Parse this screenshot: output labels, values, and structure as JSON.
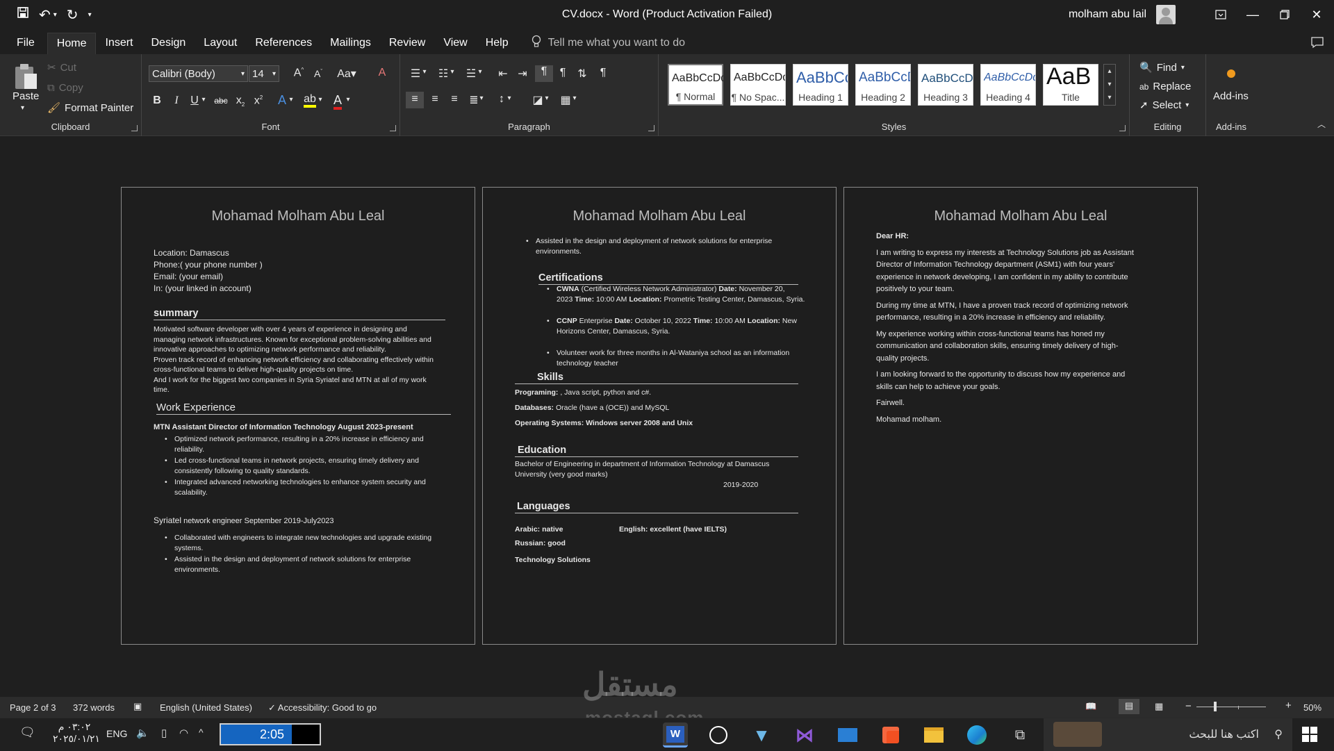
{
  "window": {
    "title": "CV.docx  -  Word (Product Activation Failed)",
    "user": "molham abu lail"
  },
  "tabs": [
    "File",
    "Home",
    "Insert",
    "Design",
    "Layout",
    "References",
    "Mailings",
    "Review",
    "View",
    "Help"
  ],
  "tell_me": "Tell me what you want to do",
  "ribbon": {
    "clipboard": {
      "paste": "Paste",
      "cut": "Cut",
      "copy": "Copy",
      "format_painter": "Format Painter",
      "label": "Clipboard"
    },
    "font": {
      "name": "Calibri (Body)",
      "size": "14",
      "label": "Font"
    },
    "paragraph": {
      "label": "Paragraph"
    },
    "styles": {
      "label": "Styles",
      "items": [
        {
          "preview": "AaBbCcDd",
          "name": "¶ Normal"
        },
        {
          "preview": "AaBbCcDd",
          "name": "¶ No Spac..."
        },
        {
          "preview": "AaBbCc",
          "name": "Heading 1"
        },
        {
          "preview": "AaBbCcD",
          "name": "Heading 2"
        },
        {
          "preview": "AaBbCcD",
          "name": "Heading 3"
        },
        {
          "preview": "AaBbCcDd",
          "name": "Heading 4"
        },
        {
          "preview": "AaB",
          "name": "Title"
        }
      ]
    },
    "editing": {
      "find": "Find",
      "replace": "Replace",
      "select": "Select",
      "label": "Editing"
    },
    "addins": {
      "button": "Add-ins",
      "label": "Add-ins"
    }
  },
  "doc": {
    "name_header": "Mohamad Molham Abu Leal",
    "page1": {
      "location": "Location: Damascus",
      "phone": "Phone:( your phone number )",
      "email": "Email: (your email)",
      "linkedin": "In: (your linked in account)",
      "summary_title": "summary",
      "summary_lines": [
        "Motivated software developer with over 4 years of experience in designing and",
        "managing network infrastructures. Known for exceptional problem-solving abilities and",
        "innovative approaches to optimizing network performance and reliability.",
        "Proven track record of enhancing network efficiency and collaborating effectively within",
        "cross-functional teams to deliver high-quality projects on time.",
        "And I work for the biggest two companies in Syria Syriatel and MTN at all of my work",
        "time."
      ],
      "work_title": "Work Experience",
      "mtn_title": "MTN Assistant Director of Information Technology August 2023-present",
      "mtn_bullets": [
        [
          "Optimized network performance, resulting in a 20% increase in efficiency and",
          "reliability."
        ],
        [
          "Led cross-functional teams in network projects, ensuring timely delivery and",
          "consistently following to quality standards."
        ],
        [
          "Integrated advanced networking technologies to enhance system security and",
          "scalability."
        ]
      ],
      "syriatel_company": "Syriatel",
      "syriatel_rest": " network engineer September 2019-July2023",
      "syriatel_bullets": [
        [
          "Collaborated with engineers to integrate new technologies and upgrade existing",
          "systems."
        ],
        [
          "Assisted in the design and deployment of network solutions for enterprise",
          "environments."
        ]
      ]
    },
    "page2": {
      "bullet": [
        "Assisted in the design and deployment of network solutions for enterprise",
        "environments."
      ],
      "cert_title": "Certifications",
      "cert1": {
        "b1": "CWNA",
        "t1": " (Certified Wireless Network Administrator) ",
        "b2": "Date:",
        "t2": " November 20,",
        "line2_a": "2023 ",
        "b3": "Time:",
        "t3": " 10:00 AM ",
        "b4": "Location:",
        "t4": " Prometric Testing Center, Damascus, Syria."
      },
      "cert2": {
        "b1": "CCNP",
        "t1": " Enterprise ",
        "b2": "Date:",
        "t2": " October 10, 2022 ",
        "b3": "Time:",
        "t3": " 10:00 AM ",
        "b4": "Location:",
        "t4": " New",
        "line2": "Horizons Center, Damascus, Syria."
      },
      "cert3": [
        "Volunteer work for three months in Al-Wataniya school as an information",
        "technology teacher"
      ],
      "skills_title": "Skills",
      "skill1_b": "Programing:",
      "skill1_t": " , Java script, python and c#.",
      "skill2_b": "Databases:",
      "skill2_t": " Oracle (have a (OCE)) and MySQL",
      "skill3_b": "Operating Systems: Windows server 2008 and Unix",
      "edu_title": "Education",
      "edu_lines": [
        "Bachelor of Engineering in department of Information Technology at Damascus",
        "University (very good marks)"
      ],
      "edu_year": "2019-2020",
      "lang_title": "Languages",
      "lang_arabic": "Arabic: native",
      "lang_english": "English: excellent (have IELTS)",
      "lang_russian": "Russian: good",
      "company": "Technology Solutions"
    },
    "page3": {
      "greeting": "Dear HR:",
      "p1": [
        "I am writing to express my interests at Technology Solutions job as Assistant",
        "Director of Information Technology department (ASM1) with four years'",
        "experience in network developing, I am confident in my ability to contribute",
        "positively to your team."
      ],
      "p2": [
        "During my time at MTN, I have a proven track record of optimizing network",
        "performance, resulting in a 20% increase in efficiency and reliability."
      ],
      "p3": [
        "My experience working within cross-functional teams has honed my",
        "communication and collaboration skills, ensuring timely delivery of high-",
        "quality projects."
      ],
      "p4": [
        "I am looking forward to the opportunity to discuss how my experience and",
        "skills can help to achieve your goals."
      ],
      "closing": "Fairwell.",
      "signature": "Mohamad molham."
    }
  },
  "status": {
    "page": "Page 2 of 3",
    "words": "372 words",
    "language": "English (United States)",
    "accessibility": "Accessibility: Good to go",
    "zoom": "50%",
    "zoom_level": 0.5
  },
  "taskbar": {
    "time_ar": "٠٣:٠٢ م",
    "date_ar": "٢٠٢٥/٠١/٢١",
    "lang": "ENG",
    "timer": "2:05",
    "search": "اكتب هنا للبحث"
  },
  "watermark": {
    "arabic": "مستقل",
    "latin": "mostaql.com"
  }
}
